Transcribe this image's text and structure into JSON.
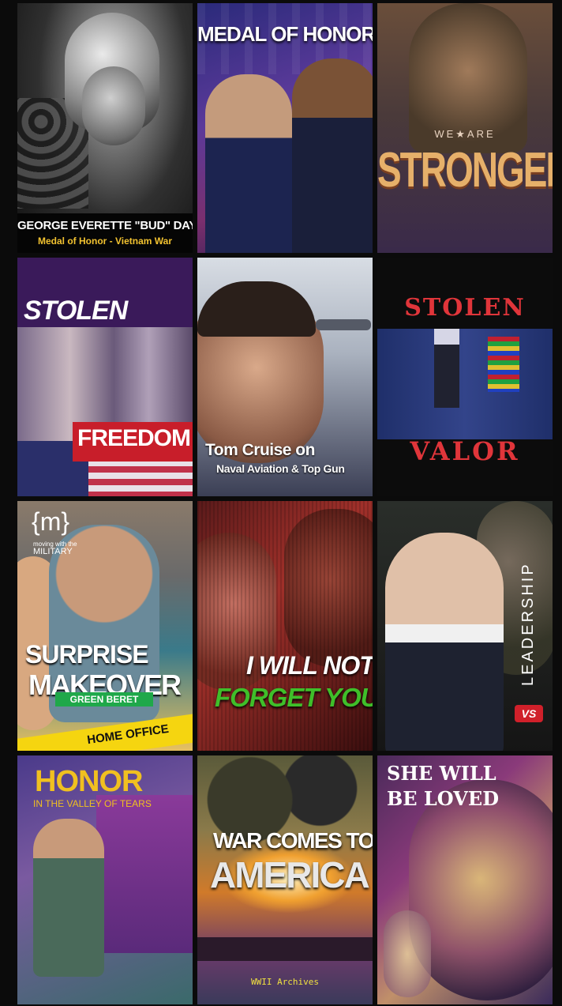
{
  "tiles": [
    {
      "line1": "GEORGE EVERETTE \"BUD\" DAY",
      "line2": "Medal of Honor - Vietnam War"
    },
    {
      "line1": "MEDAL OF HONOR"
    },
    {
      "line1": "WE★ARE",
      "line2": "STRONGER"
    },
    {
      "line1": "STOLEN",
      "line2": "FREEDOM"
    },
    {
      "line1": "Tom Cruise on",
      "line2": "Naval Aviation & Top Gun"
    },
    {
      "line1": "STOLEN",
      "line2": "VALOR"
    },
    {
      "logo": "{m}",
      "logo_sub1": "moving with the",
      "logo_sub2": "MILITARY",
      "line1": "SURPRISE",
      "line2": "MAKEOVER",
      "badge": "GREEN BERET",
      "banner": "HOME OFFICE"
    },
    {
      "line1": "I WILL NOT",
      "line2": "FORGET YOU"
    },
    {
      "line1": "LEADERSHIP",
      "badge": "VS"
    },
    {
      "line1": "HONOR",
      "line2": "IN THE VALLEY OF TEARS"
    },
    {
      "line1": "WAR COMES TO",
      "line2": "AMERICA",
      "line3": "WWII Archives"
    },
    {
      "line1": "SHE WILL",
      "line2": "BE LOVED"
    }
  ]
}
